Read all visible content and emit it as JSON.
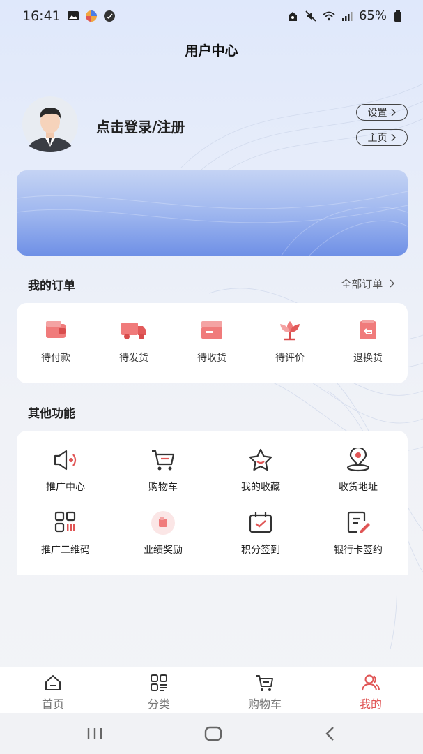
{
  "status_bar": {
    "time": "16:41",
    "battery": "65%"
  },
  "header": {
    "title": "用户中心"
  },
  "profile": {
    "login_text": "点击登录/注册",
    "settings_label": "设置",
    "home_label": "主页"
  },
  "orders": {
    "title": "我的订单",
    "all_label": "全部订单",
    "items": [
      {
        "label": "待付款",
        "icon": "wallet-icon"
      },
      {
        "label": "待发货",
        "icon": "truck-icon"
      },
      {
        "label": "待收货",
        "icon": "box-icon"
      },
      {
        "label": "待评价",
        "icon": "flower-icon"
      },
      {
        "label": "退换货",
        "icon": "return-icon"
      }
    ]
  },
  "functions": {
    "title": "其他功能",
    "items": [
      {
        "label": "推广中心",
        "icon": "speaker-icon"
      },
      {
        "label": "购物车",
        "icon": "cart-icon"
      },
      {
        "label": "我的收藏",
        "icon": "star-icon"
      },
      {
        "label": "收货地址",
        "icon": "location-icon"
      },
      {
        "label": "推广二维码",
        "icon": "qrcode-icon"
      },
      {
        "label": "业绩奖励",
        "icon": "reward-icon"
      },
      {
        "label": "积分签到",
        "icon": "calendar-check-icon"
      },
      {
        "label": "银行卡签约",
        "icon": "sign-icon"
      }
    ]
  },
  "tabbar": {
    "items": [
      {
        "label": "首页",
        "icon": "home-icon"
      },
      {
        "label": "分类",
        "icon": "category-icon"
      },
      {
        "label": "购物车",
        "icon": "cart-icon"
      },
      {
        "label": "我的",
        "icon": "user-icon"
      }
    ],
    "active_color": "#e05555"
  },
  "colors": {
    "accent": "#e05555",
    "banner": "#7a98e8"
  }
}
